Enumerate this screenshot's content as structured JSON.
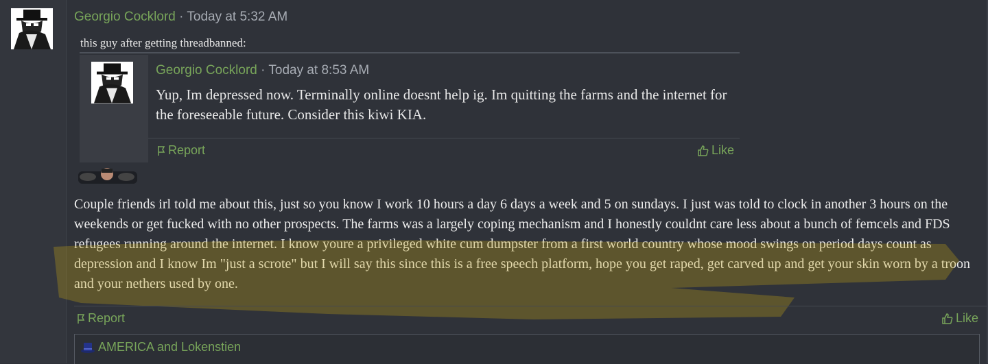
{
  "post": {
    "author": "Georgio Cocklord",
    "separator": "·",
    "timestamp": "Today at 5:32 AM",
    "quote_intro": "this guy after getting threadbanned:",
    "body": "Couple friends irl told me about this, just so you know I work 10 hours a day 6 days a week and 5 on sundays. I just was told to clock in another 3 hours on the weekends or get fucked with no other prospects. The farms was a largely coping mechanism and I honestly couldnt care less about a bunch of femcels and FDS refugees running around the internet. I know youre a privileged white cum dumpster from a first world country whose mood swings on period days count as depression and I know Im \"just a scrote\" but I will say this since this is a free speech platform, hope you get raped, get carved up and get your skin worn by a troon and your nethers used by one.",
    "report_label": "Report",
    "like_label": "Like",
    "signature": "AMERICA and Lokenstien"
  },
  "quote": {
    "author": "Georgio Cocklord",
    "separator": "·",
    "timestamp": "Today at 8:53 AM",
    "body": "Yup, Im depressed now. Terminally online doesnt help ig. Im quitting the farms and the internet for the foreseeable future. Consider this kiwi KIA.",
    "report_label": "Report",
    "like_label": "Like"
  },
  "colors": {
    "background": "#2f3239",
    "username": "#78a55a",
    "highlight": "#c9a815"
  },
  "icons": [
    "avatar-icon",
    "flag-icon",
    "thumbs-up-icon",
    "top-hat-icon"
  ]
}
